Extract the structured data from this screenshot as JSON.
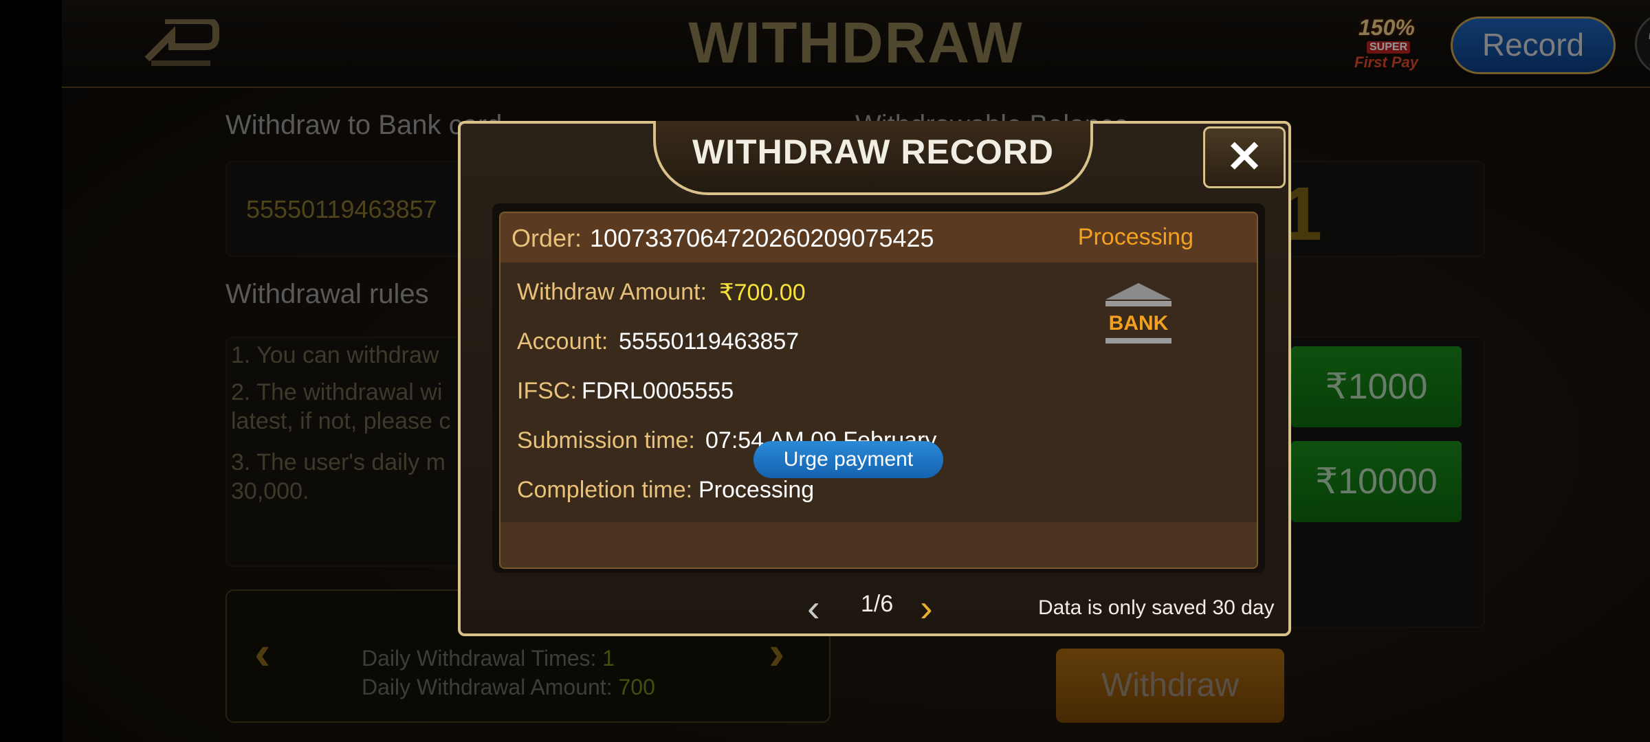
{
  "header": {
    "title": "WITHDRAW",
    "promo": {
      "percent": "150%",
      "super": "SUPER",
      "first_pay": "First Pay"
    },
    "record_label": "Record"
  },
  "page": {
    "bank_label": "Withdraw to Bank card",
    "balance_label": "Withdrawable Balance",
    "bank_value": "55550119463857",
    "balance_value": "1",
    "rules_label": "Withdrawal rules",
    "rules": [
      "1. You can withdraw",
      "2. The withdrawal wi",
      "latest, if not, please c",
      "3. The user's daily m",
      "30,000."
    ],
    "amounts": [
      "₹1000",
      "₹10000"
    ],
    "daily_times_label": "Daily Withdrawal Times:",
    "daily_times_value": "1",
    "daily_amount_label": "Daily Withdrawal Amount:",
    "daily_amount_value": "700",
    "withdraw_label": "Withdraw"
  },
  "modal": {
    "title": "WITHDRAW RECORD",
    "close_label": "✕",
    "order_label": "Order:",
    "order_number": "1007337064720260209075425",
    "status": "Processing",
    "rows": {
      "amount_label": "Withdraw Amount:",
      "amount_value": "₹700.00",
      "account_label": "Account:",
      "account_value": "55550119463857",
      "ifsc_label": "IFSC:",
      "ifsc_value": "FDRL0005555",
      "submission_label": "Submission time:",
      "submission_value": "07:54 AM 09 February",
      "completion_label": "Completion time:",
      "completion_value": "Processing"
    },
    "bank_icon_text": "BANK",
    "urge_label": "Urge payment",
    "page_indicator": "1/6",
    "note": "Data is only saved 30 day"
  },
  "colors": {
    "accent_gold": "#d9c28a",
    "status_orange": "#f4a020",
    "amount_yellow": "#f6e23a",
    "urge_blue": "#1e7ac6",
    "record_blue": "#1e63b8"
  }
}
